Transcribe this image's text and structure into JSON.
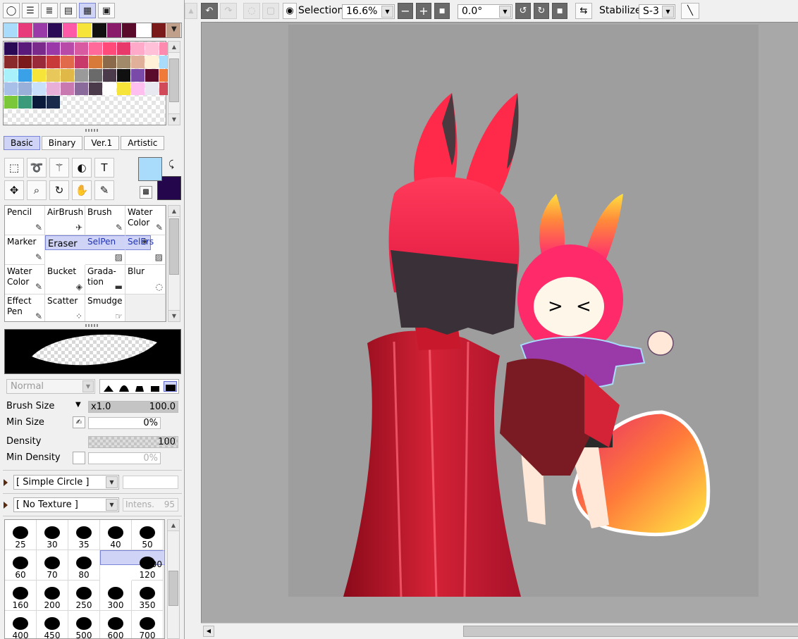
{
  "palette": {
    "swatch_row": [
      "#a8dcfa",
      "#e83a7a",
      "#9a3aa8",
      "#2a0a55",
      "#ff5aa8",
      "#f6e43a",
      "#101010",
      "#8a1a6a",
      "#5a0a2a",
      "#ffffff",
      "#7a1a1a",
      "#c0a08a"
    ],
    "grid": [
      "#2a0a55",
      "#5a1a7a",
      "#7a2a8a",
      "#9a3aa8",
      "#b84aa8",
      "#d85aa0",
      "#ff6a9a",
      "#ff4a7a",
      "#e83a6a",
      "#ffaac8",
      "#ffc0d8",
      "#ff8ab0",
      "#8a2a2a",
      "#7a1a1a",
      "#9a2a3a",
      "#c83a3a",
      "#e06a4a",
      "#c83a6a",
      "#d87a3a",
      "#8a6a4a",
      "#a08a6a",
      "#e0b09a",
      "#fff0d8",
      "#a8dcfa",
      "#a8f0fa",
      "#3aa0e8",
      "#f6e43a",
      "#e8c85a",
      "#e0b848",
      "#9a9a9a",
      "#6a6a6a",
      "#4a3a4a",
      "#101010",
      "#7a4aa8",
      "#5a0a2a",
      "#f07a3a",
      "#a8c0e8",
      "#9ab0d8",
      "#c8e0fa",
      "#e8b0d8",
      "#c87ab0",
      "#8a6a9a",
      "#4a3a4a",
      "#ffffff",
      "#f6e43a",
      "#ffc0f0",
      "#e8e8f0",
      "#d04a5a",
      "#7ac83a",
      "#3a9a7a",
      "#0a1a3a",
      "#1a2a4a"
    ]
  },
  "tabs": [
    "Basic",
    "Binary",
    "Ver.1",
    "Artistic"
  ],
  "tools": [
    {
      "name": "rect-select-icon",
      "glyph": "⬚"
    },
    {
      "name": "lasso-icon",
      "glyph": "➰"
    },
    {
      "name": "magic-wand-icon",
      "glyph": "⚚"
    },
    {
      "name": "shape-icon",
      "glyph": "◐"
    },
    {
      "name": "text-icon",
      "glyph": "T"
    },
    {
      "name": "move-icon",
      "glyph": "✥"
    },
    {
      "name": "zoom-icon",
      "glyph": "⌕"
    },
    {
      "name": "rotate-icon",
      "glyph": "↻"
    },
    {
      "name": "hand-icon",
      "glyph": "✋"
    },
    {
      "name": "eyedropper-icon",
      "glyph": "✎"
    }
  ],
  "colors": {
    "foreground": "#a8dcfa",
    "background": "#24064c",
    "accent": "#cfd3f5"
  },
  "brushes": [
    {
      "label": "Pencil",
      "icon": "✎",
      "selected": false,
      "blue": false
    },
    {
      "label": "AirBrush",
      "icon": "✈",
      "selected": false,
      "blue": false
    },
    {
      "label": "Brush",
      "icon": "✎",
      "selected": false,
      "blue": false
    },
    {
      "label": "Water\nColor",
      "icon": "✎",
      "selected": false,
      "blue": false
    },
    {
      "label": "Marker",
      "icon": "✎",
      "selected": false,
      "blue": false
    },
    {
      "label": "Eraser",
      "icon": "◈",
      "selected": true,
      "blue": false
    },
    {
      "label": "SelPen",
      "icon": "▨",
      "selected": false,
      "blue": true
    },
    {
      "label": "SelErs",
      "icon": "▨",
      "selected": false,
      "blue": true
    },
    {
      "label": "Water\nColor",
      "icon": "✎",
      "selected": false,
      "blue": false
    },
    {
      "label": "Bucket",
      "icon": "◈",
      "selected": false,
      "blue": false
    },
    {
      "label": "Grada-\ntion",
      "icon": "▬",
      "selected": false,
      "blue": false
    },
    {
      "label": "Blur",
      "icon": "◌",
      "selected": false,
      "blue": false
    },
    {
      "label": "Effect\nPen",
      "icon": "✎",
      "selected": false,
      "blue": false
    },
    {
      "label": "Scatter",
      "icon": "⁘",
      "selected": false,
      "blue": false
    },
    {
      "label": "Smudge",
      "icon": "☞",
      "selected": false,
      "blue": false
    },
    {
      "label": "",
      "icon": "",
      "selected": false,
      "blue": false
    }
  ],
  "brush_settings": {
    "blend_mode": "Normal",
    "brush_size_label": "Brush Size",
    "brush_size_mult": "x1.0",
    "brush_size_value": "100.0",
    "min_size_label": "Min Size",
    "min_size_value": "0%",
    "density_label": "Density",
    "density_value": "100",
    "min_density_label": "Min Density",
    "min_density_value": "0%",
    "shape": "[ Simple Circle ]",
    "texture": "[ No Texture ]",
    "intensity_label": "Intens.",
    "intensity_value": "95"
  },
  "sizes": [
    "25",
    "30",
    "35",
    "40",
    "50",
    "60",
    "70",
    "80",
    "100",
    "120",
    "160",
    "200",
    "250",
    "300",
    "350",
    "400",
    "450",
    "500",
    "600",
    "700"
  ],
  "selected_size": "100",
  "toolbar": {
    "selection_label": "Selection",
    "zoom": "16.6%",
    "rotation": "0.0°",
    "stabilizer_label": "Stabilizer",
    "stabilizer_value": "S-3"
  }
}
